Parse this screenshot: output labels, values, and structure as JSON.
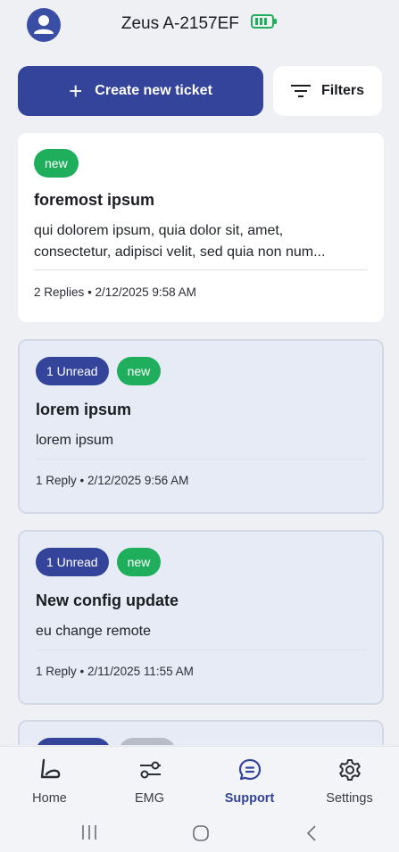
{
  "header": {
    "device_name": "Zeus A-2157EF",
    "avatar_icon": "user-avatar-icon",
    "battery_icon": "battery-icon",
    "battery_level": 0.75,
    "battery_color": "#1fae5c"
  },
  "actions": {
    "create_label": "Create new ticket",
    "create_icon": "plus-icon",
    "filters_label": "Filters",
    "filters_icon": "filter-lines-icon"
  },
  "colors": {
    "primary": "#33449a",
    "new_badge": "#1fae5c",
    "unread_card_bg": "#e7ebf5"
  },
  "tickets": [
    {
      "badges": [
        "new"
      ],
      "title": "foremost ipsum",
      "body_line1": "qui dolorem ipsum, quia dolor sit, amet,",
      "body_line2": "consectetur, adipisci velit, sed quia non num...",
      "replies": "2",
      "replies_label": "Replies",
      "date": "2/12/2025 9:58 AM",
      "unread": false
    },
    {
      "badges": [
        "1 Unread",
        "new"
      ],
      "title": "lorem ipsum",
      "body_line1": "lorem ipsum",
      "replies": "1",
      "replies_label": "Reply",
      "date": "2/12/2025 9:56 AM",
      "unread": true
    },
    {
      "badges": [
        "1 Unread",
        "new"
      ],
      "title": "New config update",
      "body_line1": "eu change remote",
      "replies": "1",
      "replies_label": "Reply",
      "date": "2/11/2025 11:55 AM",
      "unread": true
    }
  ],
  "bottom_nav": [
    {
      "label": "Home",
      "icon": "home-arm-icon",
      "active": false
    },
    {
      "label": "EMG",
      "icon": "emg-sliders-icon",
      "active": false
    },
    {
      "label": "Support",
      "icon": "chat-bubble-icon",
      "active": true
    },
    {
      "label": "Settings",
      "icon": "gear-icon",
      "active": false
    }
  ],
  "system_nav": {
    "recents_icon": "recents-icon",
    "home_icon": "home-circle-icon",
    "back_icon": "back-chevron-icon"
  }
}
